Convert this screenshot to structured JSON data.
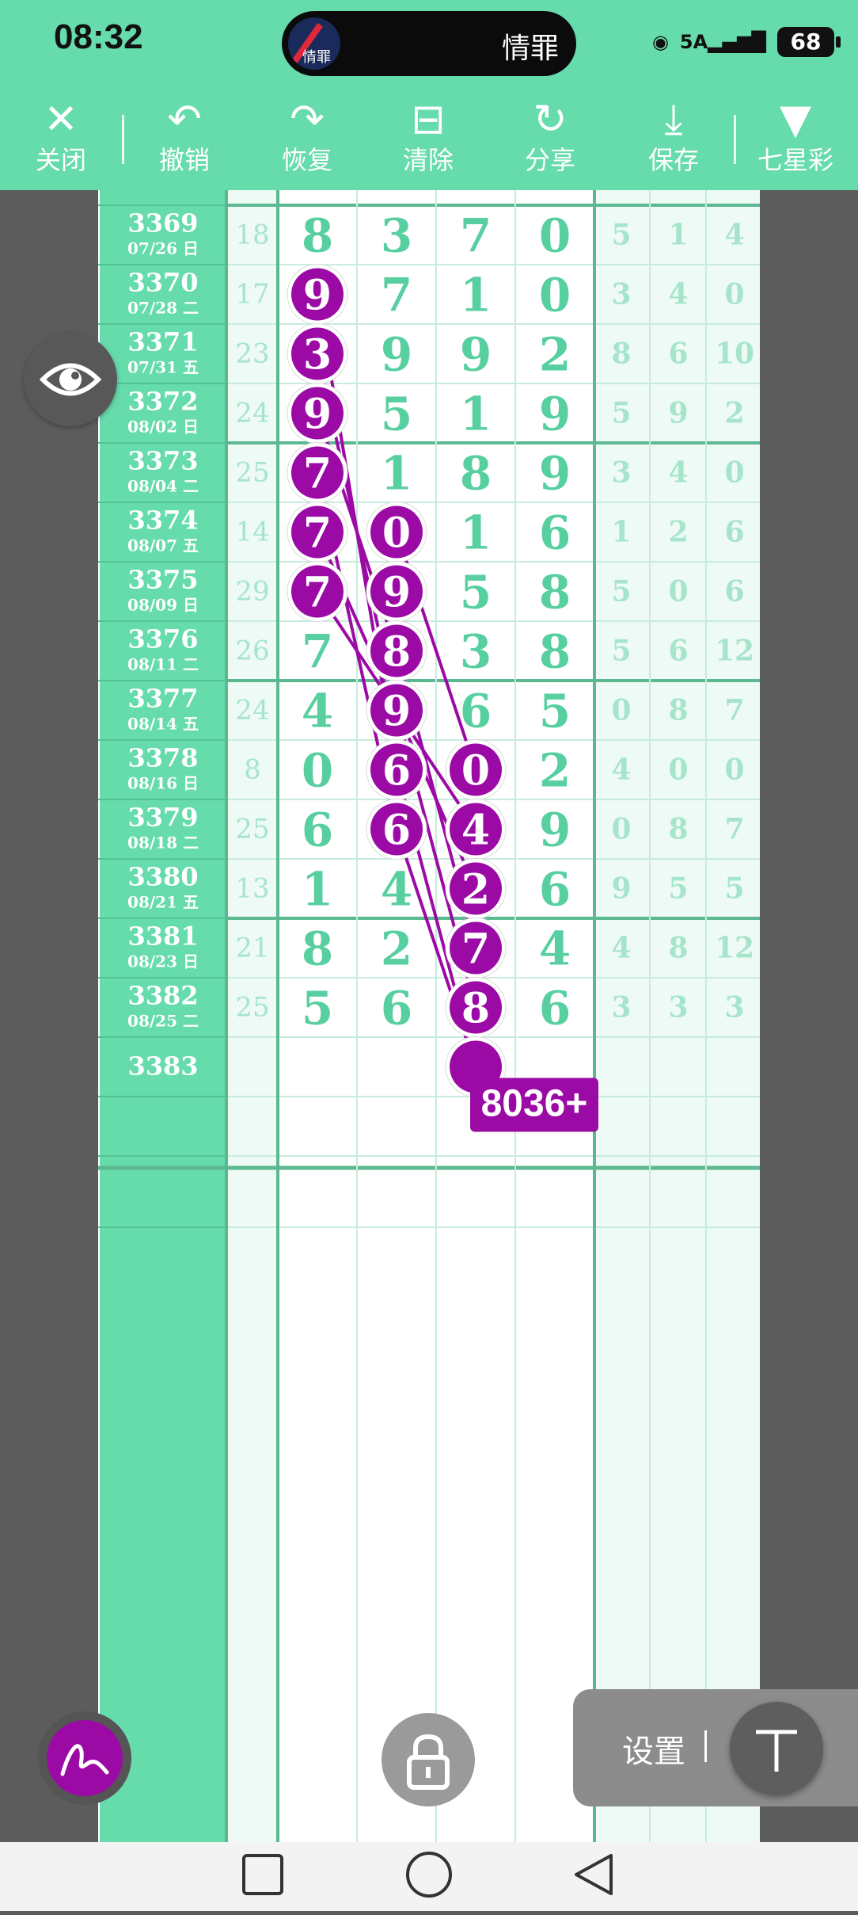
{
  "status_bar": {
    "time": "08:32",
    "island_name": "情罪",
    "island_avatar_text": "情罪",
    "network": "5A",
    "battery": "68"
  },
  "toolbar": [
    {
      "id": "close",
      "label": "关闭",
      "icon": "close-icon"
    },
    {
      "id": "undo",
      "label": "撤销",
      "icon": "undo-icon"
    },
    {
      "id": "redo",
      "label": "恢复",
      "icon": "redo-icon"
    },
    {
      "id": "clear",
      "label": "清除",
      "icon": "trash-icon"
    },
    {
      "id": "share",
      "label": "分享",
      "icon": "share-icon"
    },
    {
      "id": "save",
      "label": "保存",
      "icon": "download-icon"
    },
    {
      "id": "lottery",
      "label": "七星彩",
      "icon": "triangle-down-icon"
    }
  ],
  "rows": [
    {
      "issue": "3369",
      "date": "07/26 日",
      "sum": "18",
      "digits": [
        "8",
        "3",
        "7",
        "0"
      ],
      "extra": [
        "5",
        "1",
        "4"
      ]
    },
    {
      "issue": "3370",
      "date": "07/28 二",
      "sum": "17",
      "digits": [
        "9",
        "7",
        "1",
        "0"
      ],
      "extra": [
        "3",
        "4",
        "0"
      ]
    },
    {
      "issue": "3371",
      "date": "07/31 五",
      "sum": "23",
      "digits": [
        "3",
        "9",
        "9",
        "2"
      ],
      "extra": [
        "8",
        "6",
        "10"
      ]
    },
    {
      "issue": "3372",
      "date": "08/02 日",
      "sum": "24",
      "digits": [
        "9",
        "5",
        "1",
        "9"
      ],
      "extra": [
        "5",
        "9",
        "2"
      ]
    },
    {
      "issue": "3373",
      "date": "08/04 二",
      "sum": "25",
      "digits": [
        "7",
        "1",
        "8",
        "9"
      ],
      "extra": [
        "3",
        "4",
        "0"
      ]
    },
    {
      "issue": "3374",
      "date": "08/07 五",
      "sum": "14",
      "digits": [
        "7",
        "0",
        "1",
        "6"
      ],
      "extra": [
        "1",
        "2",
        "6"
      ]
    },
    {
      "issue": "3375",
      "date": "08/09 日",
      "sum": "29",
      "digits": [
        "7",
        "9",
        "5",
        "8"
      ],
      "extra": [
        "5",
        "0",
        "6"
      ]
    },
    {
      "issue": "3376",
      "date": "08/11 二",
      "sum": "26",
      "digits": [
        "7",
        "8",
        "3",
        "8"
      ],
      "extra": [
        "5",
        "6",
        "12"
      ]
    },
    {
      "issue": "3377",
      "date": "08/14 五",
      "sum": "24",
      "digits": [
        "4",
        "9",
        "6",
        "5"
      ],
      "extra": [
        "0",
        "8",
        "7"
      ]
    },
    {
      "issue": "3378",
      "date": "08/16 日",
      "sum": "8",
      "digits": [
        "0",
        "6",
        "0",
        "2"
      ],
      "extra": [
        "4",
        "0",
        "0"
      ]
    },
    {
      "issue": "3379",
      "date": "08/18 二",
      "sum": "25",
      "digits": [
        "6",
        "6",
        "4",
        "9"
      ],
      "extra": [
        "0",
        "8",
        "7"
      ]
    },
    {
      "issue": "3380",
      "date": "08/21 五",
      "sum": "13",
      "digits": [
        "1",
        "4",
        "2",
        "6"
      ],
      "extra": [
        "9",
        "5",
        "5"
      ]
    },
    {
      "issue": "3381",
      "date": "08/23 日",
      "sum": "21",
      "digits": [
        "8",
        "2",
        "7",
        "4"
      ],
      "extra": [
        "4",
        "8",
        "12"
      ]
    },
    {
      "issue": "3382",
      "date": "08/25 二",
      "sum": "25",
      "digits": [
        "5",
        "6",
        "8",
        "6"
      ],
      "extra": [
        "3",
        "3",
        "3"
      ]
    },
    {
      "issue": "3383",
      "date": "",
      "sum": "",
      "digits": [
        "",
        "",
        "",
        ""
      ],
      "extra": [
        "",
        "",
        ""
      ]
    }
  ],
  "marks": [
    {
      "row": 1,
      "col": 0
    },
    {
      "row": 2,
      "col": 0
    },
    {
      "row": 3,
      "col": 0
    },
    {
      "row": 4,
      "col": 0
    },
    {
      "row": 5,
      "col": 0
    },
    {
      "row": 6,
      "col": 0
    },
    {
      "row": 5,
      "col": 1
    },
    {
      "row": 6,
      "col": 1
    },
    {
      "row": 7,
      "col": 1
    },
    {
      "row": 8,
      "col": 1
    },
    {
      "row": 9,
      "col": 1
    },
    {
      "row": 10,
      "col": 1
    },
    {
      "row": 9,
      "col": 2
    },
    {
      "row": 10,
      "col": 2
    },
    {
      "row": 11,
      "col": 2
    },
    {
      "row": 12,
      "col": 2
    },
    {
      "row": 13,
      "col": 2
    },
    {
      "row": 14,
      "col": 2
    }
  ],
  "lines": [
    [
      [
        1,
        0
      ],
      [
        9,
        1
      ],
      [
        14,
        2
      ]
    ],
    [
      [
        2,
        0
      ],
      [
        8,
        1
      ],
      [
        13,
        2
      ]
    ],
    [
      [
        3,
        0
      ],
      [
        7,
        1
      ],
      [
        12,
        2
      ]
    ],
    [
      [
        4,
        0
      ],
      [
        10,
        1
      ],
      [
        14,
        2
      ]
    ],
    [
      [
        5,
        0
      ],
      [
        11,
        2
      ]
    ],
    [
      [
        6,
        0
      ],
      [
        10,
        2
      ]
    ],
    [
      [
        5,
        1
      ],
      [
        9,
        2
      ]
    ],
    [
      [
        6,
        1
      ],
      [
        10,
        1
      ]
    ]
  ],
  "prediction_label": "8036+",
  "settings_label": "设置",
  "colors": {
    "accent": "#66dbac",
    "mark": "#9c0aa6",
    "digit": "#58cfa0",
    "light": "#a6e5cb",
    "grid": "#c8ecdc",
    "thick": "#5bb890"
  }
}
